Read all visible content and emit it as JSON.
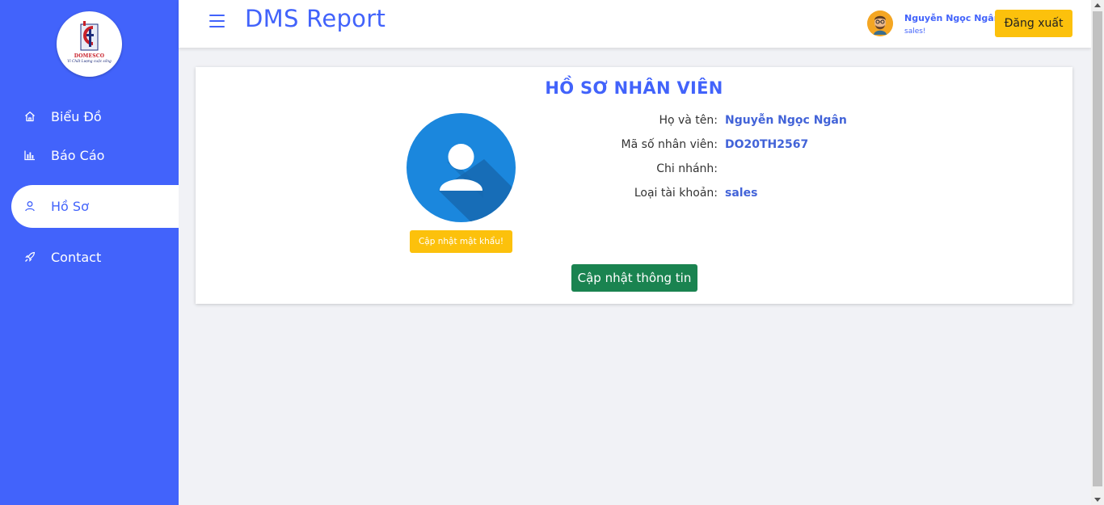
{
  "sidebar": {
    "logo": {
      "brand": "DOMESCO",
      "slogan": "Vì Chất Lượng cuộc sống"
    },
    "items": [
      {
        "label": "Biểu Đồ",
        "icon": "home-icon"
      },
      {
        "label": "Báo Cáo",
        "icon": "bar-chart-icon"
      },
      {
        "label": "Hồ Sơ",
        "icon": "user-icon",
        "active": true
      },
      {
        "label": "Contact",
        "icon": "rocket-icon"
      }
    ]
  },
  "header": {
    "title": "DMS Report",
    "user": {
      "name": "Nguyễn Ngọc Ngân",
      "role": "sales!"
    },
    "logout_label": "Đăng xuất"
  },
  "profile": {
    "title": "HỒ SƠ NHÂN VIÊN",
    "change_password_label": "Cập nhật mật khẩu!",
    "fields": [
      {
        "label": "Họ và tên:",
        "value": "Nguyễn Ngọc Ngân"
      },
      {
        "label": "Mã số nhân viên:",
        "value": "DO20TH2567"
      },
      {
        "label": "Chi nhánh:",
        "value": ""
      },
      {
        "label": "Loại tài khoản:",
        "value": "sales"
      }
    ],
    "update_label": "Cập nhật thông tin"
  },
  "colors": {
    "primary": "#4263fb",
    "warning": "#fcc10c",
    "success": "#1a8350",
    "avatar_blue": "#1b87dd"
  }
}
